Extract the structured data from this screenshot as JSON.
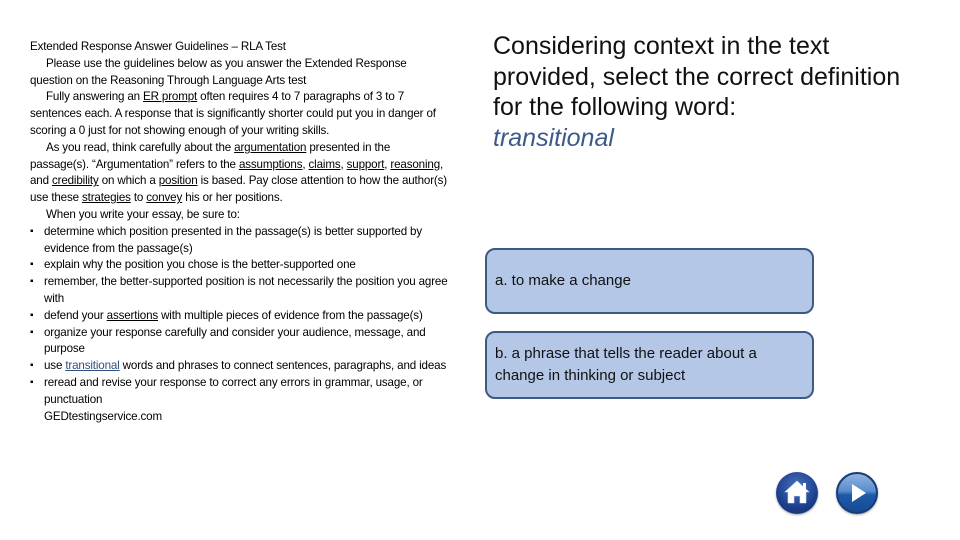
{
  "guidelines": {
    "title": "Extended Response Answer Guidelines – RLA Test",
    "intro": "Please use the guidelines below as you answer the Extended Response question on the Reasoning Through Language Arts test",
    "para1": {
      "before": "Fully answering an ",
      "link": "ER prompt",
      "after": " often requires 4 to 7 paragraphs of 3 to 7 sentences each.  A response that is significantly shorter could put you in danger of scoring a 0 just for not showing enough of your writing skills."
    },
    "para2": {
      "t1": "As you read, think carefully about the ",
      "u1": "argumentation",
      "t2": " presented in the passage(s). “Argumentation” refers to the ",
      "u2": "assumptions",
      "t3": ", ",
      "u3": "claims",
      "t4": ", ",
      "u4": "support",
      "t5": ", ",
      "u5": "reasoning",
      "t6": ", and ",
      "u6": "credibility",
      "t7": " on which a ",
      "u7": "position",
      "t8": " is based. Pay close attention to how the author(s) use these ",
      "u8": "strategies",
      "t9": " to ",
      "u9": "convey",
      "t10": " his or her positions."
    },
    "lead": "When you write your essay, be sure to:",
    "bullet_glyph": "▪",
    "bullets": {
      "b1": "determine which position presented in the passage(s) is better supported by evidence from the passage(s)",
      "b2": "explain why the position you chose is the better-supported one",
      "b3": "remember, the better-supported position is not necessarily the position you agree with",
      "b4_before": "defend your ",
      "b4_link": "assertions",
      "b4_after": " with multiple pieces of evidence from the passage(s)",
      "b5": "organize your response carefully and consider your audience, message, and purpose",
      "b6_before": "use ",
      "b6_link": "transitional",
      "b6_after": " words and phrases to connect sentences, paragraphs, and ideas",
      "b7": "reread and revise your response to correct any errors in grammar, usage, or punctuation"
    },
    "source": "GEDtestingservice.com"
  },
  "question": {
    "prompt": "Considering context in the text provided, select the correct definition for the following word:",
    "word": "transitional"
  },
  "answers": {
    "a": "a. to make a change",
    "b": "b. a phrase that tells the reader about a change in thinking or subject"
  },
  "nav": {
    "home_icon": "home-icon",
    "next_icon": "play-next-icon"
  },
  "colors": {
    "answer_fill": "#b4c7e7",
    "answer_border": "#3d5a85",
    "highlight_word": "#3b5a8a"
  }
}
